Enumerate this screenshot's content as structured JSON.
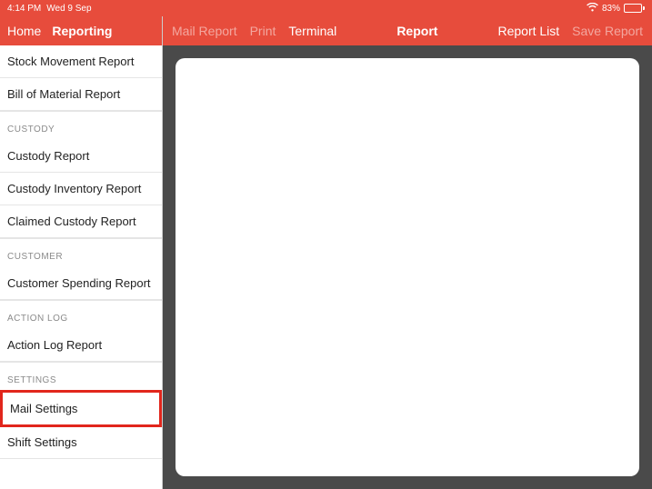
{
  "status": {
    "time": "4:14 PM",
    "date": "Wed 9 Sep",
    "battery_pct": "83%"
  },
  "sidebar": {
    "home_label": "Home",
    "title": "Reporting",
    "top_items": [
      {
        "label": "Stock Movement Report"
      },
      {
        "label": "Bill of Material Report"
      }
    ],
    "sections": [
      {
        "header": "CUSTODY",
        "items": [
          {
            "label": "Custody Report"
          },
          {
            "label": "Custody Inventory Report"
          },
          {
            "label": "Claimed Custody Report"
          }
        ]
      },
      {
        "header": "CUSTOMER",
        "items": [
          {
            "label": "Customer Spending Report"
          }
        ]
      },
      {
        "header": "ACTION LOG",
        "items": [
          {
            "label": "Action Log Report"
          }
        ]
      },
      {
        "header": "SETTINGS",
        "items": [
          {
            "label": "Mail Settings"
          },
          {
            "label": "Shift Settings"
          }
        ]
      }
    ]
  },
  "main_header": {
    "mail_report": "Mail Report",
    "print": "Print",
    "terminal": "Terminal",
    "title": "Report",
    "report_list": "Report List",
    "save_report": "Save Report"
  }
}
